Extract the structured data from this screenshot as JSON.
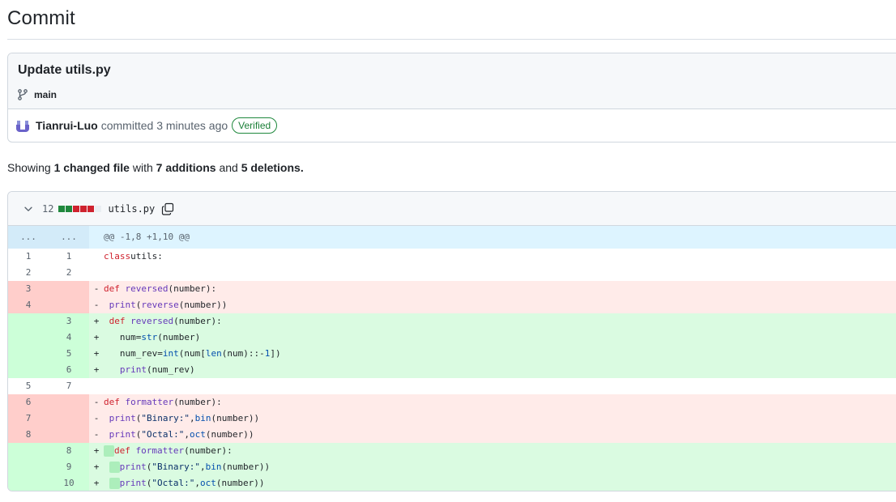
{
  "page": {
    "title": "Commit"
  },
  "commit": {
    "message": "Update utils.py",
    "branch": "main",
    "author": "Tianrui-Luo",
    "action": "committed 3 minutes ago",
    "badge": "Verified"
  },
  "summary": {
    "prefix": "Showing",
    "files": "1 changed file",
    "mid1": "with",
    "additions": "7 additions",
    "mid2": "and",
    "deletions": "5 deletions."
  },
  "file": {
    "change_count": "12",
    "filename": "utils.py",
    "diffstat_colors": [
      "#1f883d",
      "#1f883d",
      "#cf222e",
      "#cf222e",
      "#cf222e",
      "#eaeef2"
    ]
  },
  "diff": {
    "hunk_left": "...",
    "hunk_right": "...",
    "hunk_header": "@@ -1,8 +1,10 @@",
    "lines": [
      {
        "type": "ctx",
        "old": "1",
        "new": "1",
        "sign": "",
        "tokens": [
          [
            "kw",
            "class"
          ],
          [
            "",
            "utils:"
          ]
        ]
      },
      {
        "type": "ctx",
        "old": "2",
        "new": "2",
        "sign": "",
        "tokens": []
      },
      {
        "type": "del",
        "old": "3",
        "new": "",
        "sign": "-",
        "tokens": [
          [
            "kw",
            "def"
          ],
          [
            "",
            " "
          ],
          [
            "fn",
            "reversed"
          ],
          [
            "",
            "(number):"
          ]
        ]
      },
      {
        "type": "del",
        "old": "4",
        "new": "",
        "sign": "-",
        "tokens": [
          [
            "",
            " "
          ],
          [
            "fn",
            "print"
          ],
          [
            "",
            "("
          ],
          [
            "fn",
            "reverse"
          ],
          [
            "",
            "(number))"
          ]
        ]
      },
      {
        "type": "add",
        "old": "",
        "new": "3",
        "sign": "+",
        "tokens": [
          [
            "",
            " "
          ],
          [
            "kw",
            "def"
          ],
          [
            "",
            " "
          ],
          [
            "fn",
            "reversed"
          ],
          [
            "",
            "(number):"
          ]
        ]
      },
      {
        "type": "add",
        "old": "",
        "new": "4",
        "sign": "+",
        "tokens": [
          [
            "",
            "   num="
          ],
          [
            "bi",
            "str"
          ],
          [
            "",
            "(number)"
          ]
        ]
      },
      {
        "type": "add",
        "old": "",
        "new": "5",
        "sign": "+",
        "tokens": [
          [
            "",
            "   num_rev="
          ],
          [
            "bi",
            "int"
          ],
          [
            "",
            "(num["
          ],
          [
            "bi",
            "len"
          ],
          [
            "",
            "(num)::-"
          ],
          [
            "bi",
            "1"
          ],
          [
            "",
            "])"
          ]
        ]
      },
      {
        "type": "add",
        "old": "",
        "new": "6",
        "sign": "+",
        "tokens": [
          [
            "",
            "   "
          ],
          [
            "fn",
            "print"
          ],
          [
            "",
            "(num_rev)"
          ]
        ]
      },
      {
        "type": "ctx",
        "old": "5",
        "new": "7",
        "sign": "",
        "tokens": []
      },
      {
        "type": "del",
        "old": "6",
        "new": "",
        "sign": "-",
        "tokens": [
          [
            "kw",
            "def"
          ],
          [
            "",
            " "
          ],
          [
            "fn",
            "formatter"
          ],
          [
            "",
            "(number):"
          ]
        ]
      },
      {
        "type": "del",
        "old": "7",
        "new": "",
        "sign": "-",
        "tokens": [
          [
            "",
            " "
          ],
          [
            "fn",
            "print"
          ],
          [
            "",
            "("
          ],
          [
            "st",
            "\"Binary:\""
          ],
          [
            "",
            ","
          ],
          [
            "bi",
            "bin"
          ],
          [
            "",
            "(number))"
          ]
        ]
      },
      {
        "type": "del",
        "old": "8",
        "new": "",
        "sign": "-",
        "tokens": [
          [
            "",
            " "
          ],
          [
            "fn",
            "print"
          ],
          [
            "",
            "("
          ],
          [
            "st",
            "\"Octal:\""
          ],
          [
            "",
            ","
          ],
          [
            "bi",
            "oct"
          ],
          [
            "",
            "(number))"
          ]
        ]
      },
      {
        "type": "add",
        "old": "",
        "new": "8",
        "sign": "+",
        "tokens": [
          [
            "hl",
            ""
          ],
          [
            "kw",
            "def"
          ],
          [
            "",
            " "
          ],
          [
            "fn",
            "formatter"
          ],
          [
            "",
            "(number):"
          ]
        ]
      },
      {
        "type": "add",
        "old": "",
        "new": "9",
        "sign": "+",
        "tokens": [
          [
            "",
            " "
          ],
          [
            "hl",
            ""
          ],
          [
            "fn",
            "print"
          ],
          [
            "",
            "("
          ],
          [
            "st",
            "\"Binary:\""
          ],
          [
            "",
            ","
          ],
          [
            "bi",
            "bin"
          ],
          [
            "",
            "(number))"
          ]
        ]
      },
      {
        "type": "add",
        "old": "",
        "new": "10",
        "sign": "+",
        "tokens": [
          [
            "",
            " "
          ],
          [
            "hl",
            ""
          ],
          [
            "fn",
            "print"
          ],
          [
            "",
            "("
          ],
          [
            "st",
            "\"Octal:\""
          ],
          [
            "",
            ","
          ],
          [
            "bi",
            "oct"
          ],
          [
            "",
            "(number))"
          ]
        ]
      }
    ]
  },
  "icons": {
    "branch": "git-branch-icon",
    "avatar": "user-avatar",
    "chevron": "chevron-down-icon",
    "copy": "copy-icon"
  },
  "colors": {
    "add": "#dafbe1",
    "del": "#ffebe9",
    "hunk": "#ddf4ff",
    "verified": "#1a7f37"
  }
}
